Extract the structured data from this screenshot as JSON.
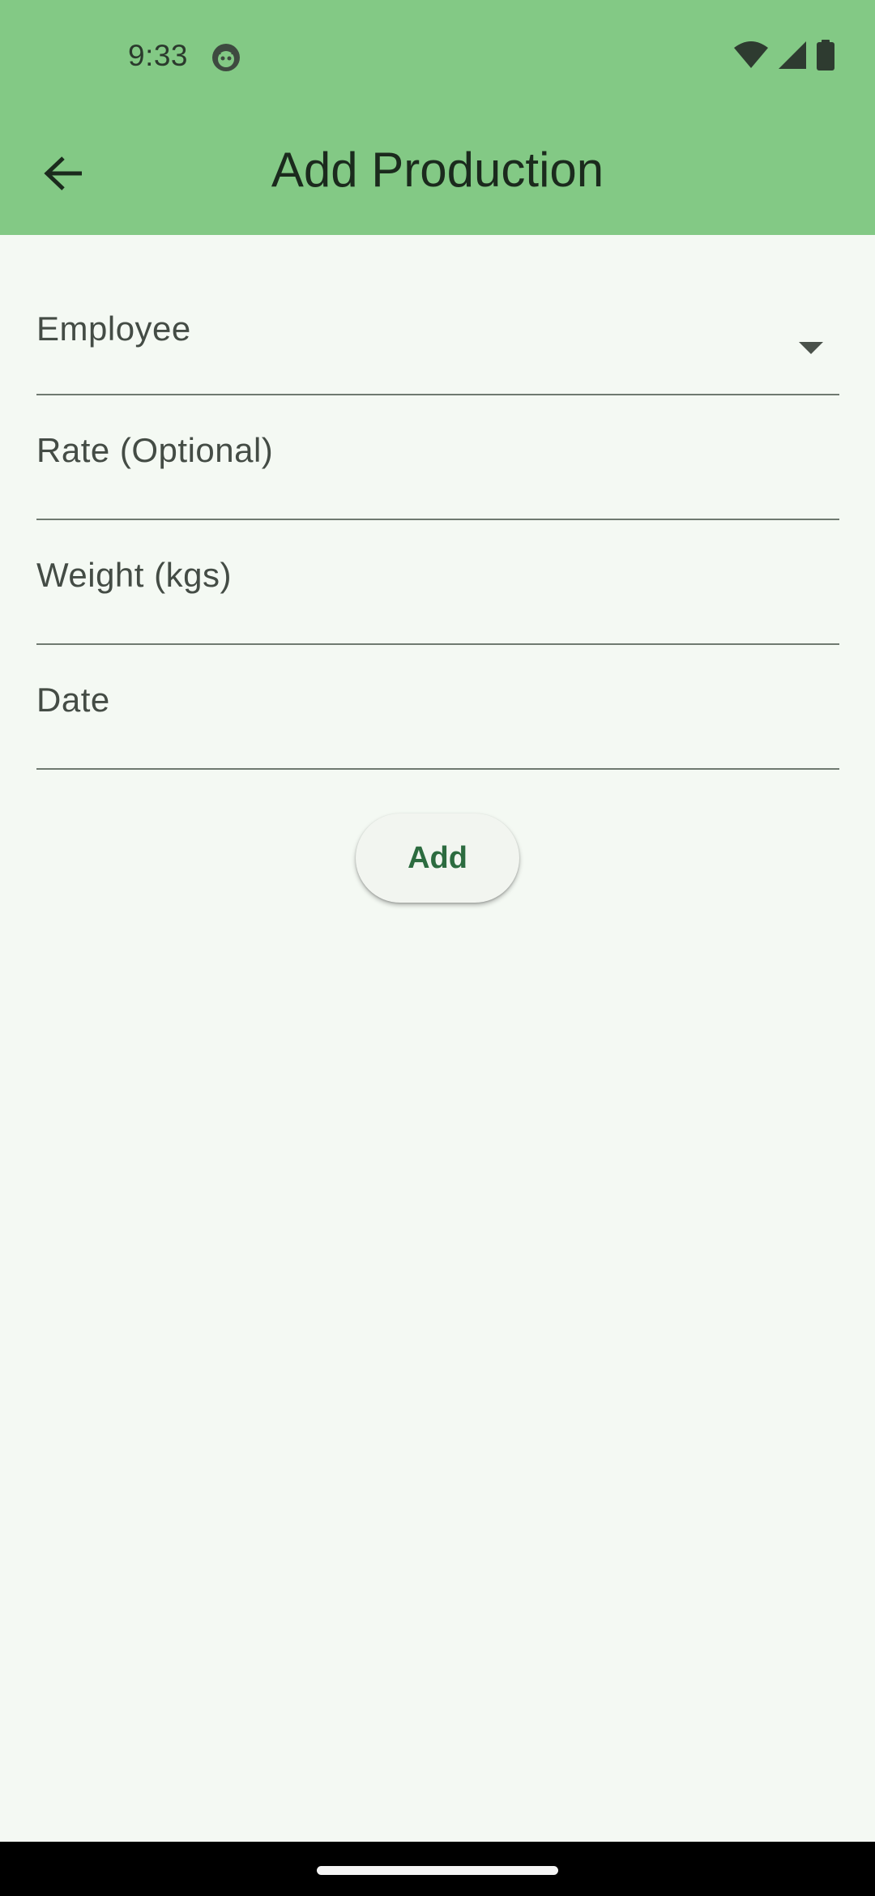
{
  "status_bar": {
    "time": "9:33",
    "icons": [
      "app-notification-icon",
      "wifi-icon",
      "cell-signal-icon",
      "battery-icon"
    ]
  },
  "app_bar": {
    "title": "Add Production",
    "back_icon": "arrow-back-icon",
    "background_color": "#83c985"
  },
  "form": {
    "employee": {
      "label": "Employee",
      "icon": "dropdown-caret-icon"
    },
    "rate": {
      "label": "Rate (Optional)"
    },
    "weight": {
      "label": "Weight (kgs)"
    },
    "date": {
      "label": "Date"
    }
  },
  "add_button": {
    "label": "Add",
    "color": "#2c6b3f"
  },
  "colors": {
    "background": "#f4f9f3",
    "text_primary": "#1b2a1d",
    "field_label": "#444c45",
    "underline": "#6f7a70"
  }
}
